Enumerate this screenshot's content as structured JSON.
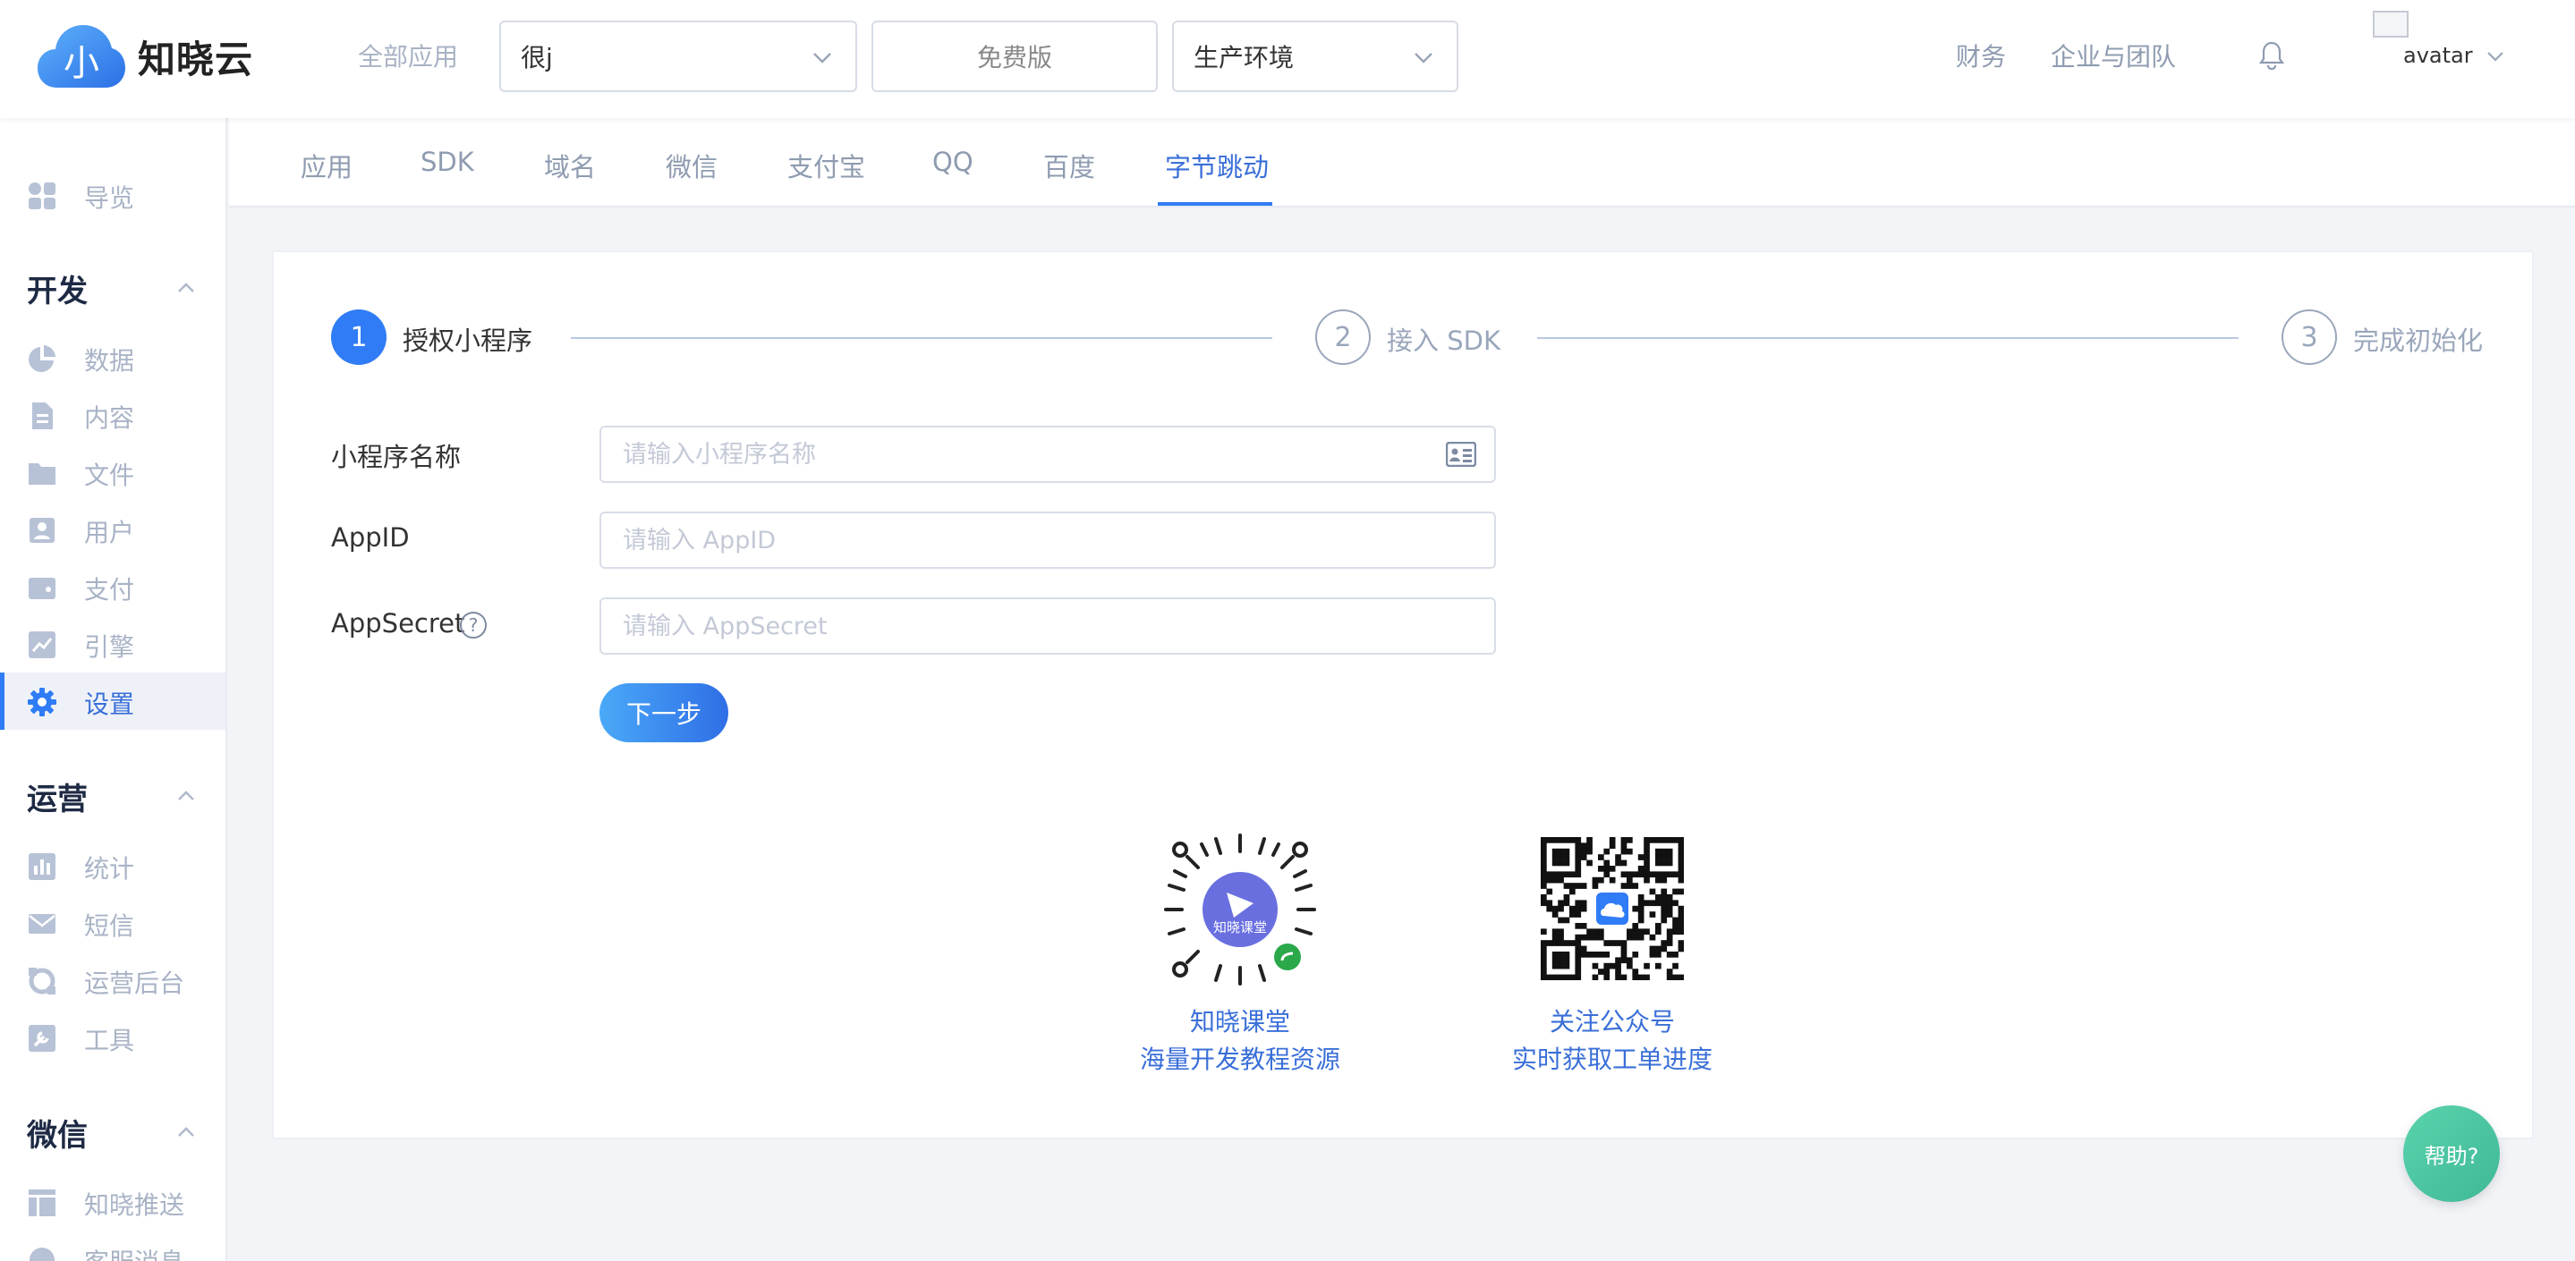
{
  "brand": {
    "name": "知晓云",
    "logo_glyph": "小",
    "logo_color": "#2f7cf6"
  },
  "header": {
    "all_apps_label": "全部应用",
    "app_select": {
      "value": "很j"
    },
    "plan_button": "免费版",
    "env_select": {
      "value": "生产环境"
    },
    "nav": [
      "财务",
      "企业与团队"
    ],
    "avatar_alt": "avatar"
  },
  "sidebar": {
    "overview": "导览",
    "groups": [
      {
        "title": "开发",
        "items": [
          "数据",
          "内容",
          "文件",
          "用户",
          "支付",
          "引擎",
          "设置"
        ]
      },
      {
        "title": "运营",
        "items": [
          "统计",
          "短信",
          "运营后台",
          "工具"
        ]
      },
      {
        "title": "微信",
        "items": [
          "知晓推送",
          "客服消息"
        ]
      }
    ],
    "active_item": "设置"
  },
  "tabs": [
    "应用",
    "SDK",
    "域名",
    "微信",
    "支付宝",
    "QQ",
    "百度",
    "字节跳动"
  ],
  "active_tab": "字节跳动",
  "steps": [
    {
      "num": "1",
      "label": "授权小程序",
      "state": "active"
    },
    {
      "num": "2",
      "label": "接入 SDK",
      "state": "todo"
    },
    {
      "num": "3",
      "label": "完成初始化",
      "state": "todo"
    }
  ],
  "form": {
    "name_label": "小程序名称",
    "name_placeholder": "请输入小程序名称",
    "appid_label": "AppID",
    "appid_placeholder": "请输入 AppID",
    "secret_label": "AppSecret",
    "secret_placeholder": "请输入 AppSecret",
    "help_glyph": "?",
    "next_button": "下一步"
  },
  "qr": [
    {
      "line1": "知晓课堂",
      "line2": "海量开发教程资源",
      "inner_text": "知晓课堂"
    },
    {
      "line1": "关注公众号",
      "line2": "实时获取工单进度"
    }
  ],
  "help_button": "帮助?",
  "colors": {
    "accent": "#2f7cf6",
    "help": "#4cc8a2",
    "muted": "#a9b3c6"
  }
}
